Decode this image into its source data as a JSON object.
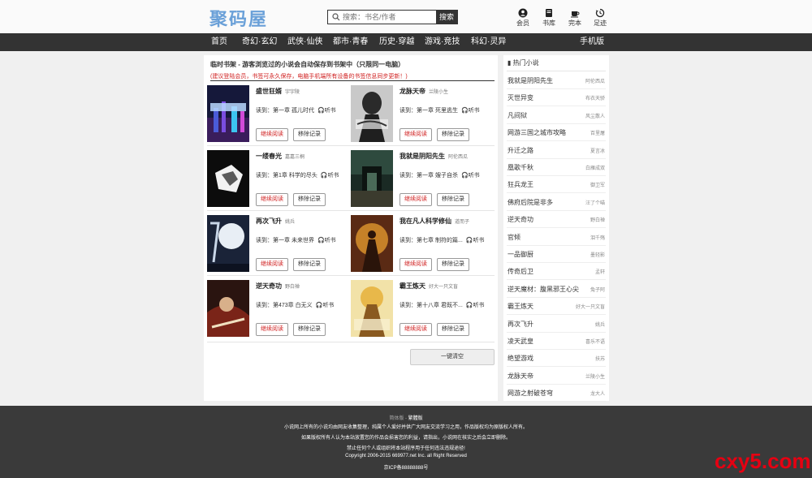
{
  "header": {
    "logo": "聚码屋",
    "search": {
      "placeholder": "搜索：书名/作者",
      "button": "搜索"
    },
    "tools": [
      {
        "label": "会员",
        "icon": "user-icon"
      },
      {
        "label": "书库",
        "icon": "book-icon"
      },
      {
        "label": "完本",
        "icon": "cup-icon"
      },
      {
        "label": "足迹",
        "icon": "history-icon"
      }
    ]
  },
  "nav": {
    "items": [
      "首页",
      "奇幻·玄幻",
      "武侠·仙侠",
      "都市·青春",
      "历史·穿越",
      "游戏·竞技",
      "科幻·灵异"
    ],
    "mobile": "手机版"
  },
  "main": {
    "notice_title": "临时书架 - 游客浏览过的小说会自动保存到书架中（只限同一电脑）",
    "notice_tip": "(建议登陆会员，书签可永久保存，电脑手机端所有设备的书签信息同步更新！)",
    "read_prefix": "读到：",
    "listen_label": "听书",
    "continue_label": "继续阅读",
    "remove_label": "移除记录",
    "clear_label": "一键清空",
    "books": [
      {
        "title": "盛世狂婿",
        "author": "宇宇陵",
        "chapter": "第一章 孤儿时代"
      },
      {
        "title": "龙脉天帝",
        "author": "兰陵小生",
        "chapter": "第一章 死里逃生"
      },
      {
        "title": "一缕春光",
        "author": "嘉嘉三桐",
        "chapter": "第1章 科学的尽头"
      },
      {
        "title": "我就是阴阳先生",
        "author": "阿伦西瓜",
        "chapter": "第一章 嫂子自杀"
      },
      {
        "title": "再次飞升",
        "author": "姚兵",
        "chapter": "第一章 未来世界"
      },
      {
        "title": "我在凡人科学修仙",
        "author": "道而子",
        "chapter": "第七章 制符的篇..."
      },
      {
        "title": "逆天奇功",
        "author": "野白禅",
        "chapter": "第473章 白无义"
      },
      {
        "title": "霸王炼天",
        "author": "好大一只文盲",
        "chapter": "第十八章 君既不..."
      }
    ]
  },
  "sidebar": {
    "title": "热门小说",
    "items": [
      {
        "name": "我就是阴阳先生",
        "author": "阿伦西瓜"
      },
      {
        "name": "灭世异变",
        "author": "布衣天骄"
      },
      {
        "name": "凡间狱",
        "author": "风尘散人"
      },
      {
        "name": "网游三国之城市攻略",
        "author": "百里屠"
      },
      {
        "name": "升迁之路",
        "author": "夏言冰"
      },
      {
        "name": "凰歌千秋",
        "author": "白雁成双"
      },
      {
        "name": "狂兵龙王",
        "author": "御卫军"
      },
      {
        "name": "佛府后院是非多",
        "author": "汪了个喵"
      },
      {
        "name": "逆天奇功",
        "author": "野白禅"
      },
      {
        "name": "官倾",
        "author": "泪千殇"
      },
      {
        "name": "一品御厨",
        "author": "墨轻影"
      },
      {
        "name": "传奇后卫",
        "author": "孟轩"
      },
      {
        "name": "逆天魔材：腹黑邪王心尖",
        "author": "兔子阿"
      },
      {
        "name": "霸王炼天",
        "author": "好大一只文盲"
      },
      {
        "name": "再次飞升",
        "author": "姚兵"
      },
      {
        "name": "凌天武皇",
        "author": "喜乐不语"
      },
      {
        "name": "绝望游戏",
        "author": "扶苏"
      },
      {
        "name": "龙脉天帝",
        "author": "兰陵小生"
      },
      {
        "name": "网游之射破苍穹",
        "author": "龙大人"
      }
    ]
  },
  "footer": {
    "switch_simple": "简体版",
    "switch_sep": " · ",
    "switch_trad": "繁體版",
    "line1": "小说网上所有的小说均由网友收集整理，纯属个人爱好并供广大网友交流学习之用，作品版权均为原版权人所有。",
    "line2": "如果版权所有人认为本站放置您的作品会损害您的利益，请指出，小说网在核实之后会立即删除。",
    "line3": "禁止任何个人或组织将本站程序用于任何违法违规途径!",
    "line4": "Copyright 2006-2015 669977.net Inc. all Right Reserved",
    "line5": "京ICP备88888888号"
  },
  "watermark": "cxy5.com"
}
